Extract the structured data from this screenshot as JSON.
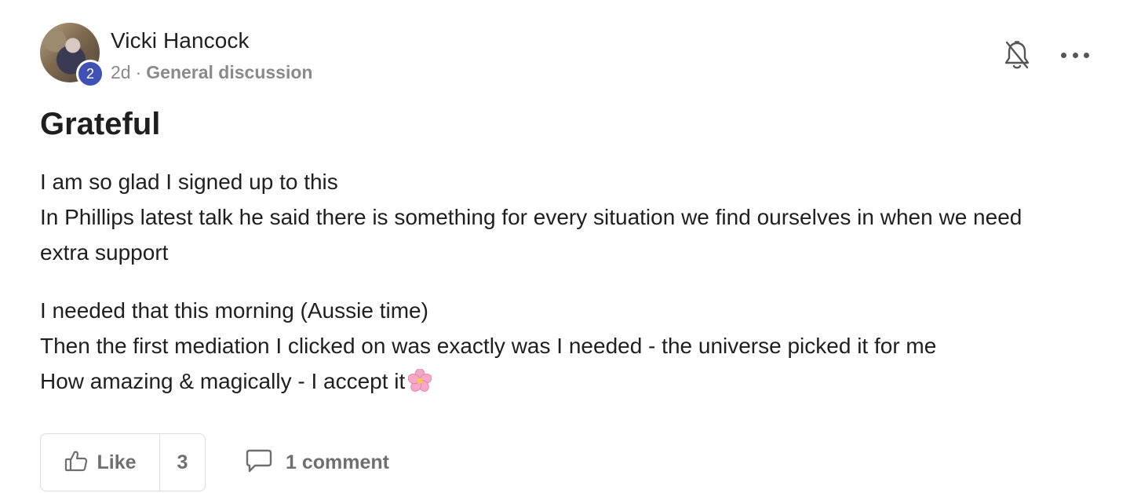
{
  "post": {
    "author": {
      "name": "Vicki Hancock",
      "level": "2",
      "avatar_icon": "user-avatar-photo"
    },
    "meta": {
      "age": "2d",
      "separator": "·",
      "category": "General discussion"
    },
    "actions": {
      "notifications_icon": "bell-off-icon",
      "more_icon": "more-horizontal-icon"
    },
    "title": "Grateful",
    "body": {
      "paragraph1": [
        "I am so glad I signed up to this",
        "In Phillips latest talk he said there is something for every situation we find ourselves in when we need",
        "extra support"
      ],
      "paragraph2": [
        "I needed that this morning (Aussie time)",
        "Then the first mediation I clicked on was exactly was I needed - the universe picked it for me",
        "How amazing & magically - I accept it"
      ],
      "emoji": "cherry-blossom-icon"
    },
    "footer": {
      "like_label": "Like",
      "like_count": "3",
      "comment_label": "1 comment"
    }
  },
  "colors": {
    "level_badge": "#3f51b5",
    "text_primary": "#1f1f1f",
    "text_muted": "#8a8a8a",
    "border": "#dcdcdc"
  }
}
